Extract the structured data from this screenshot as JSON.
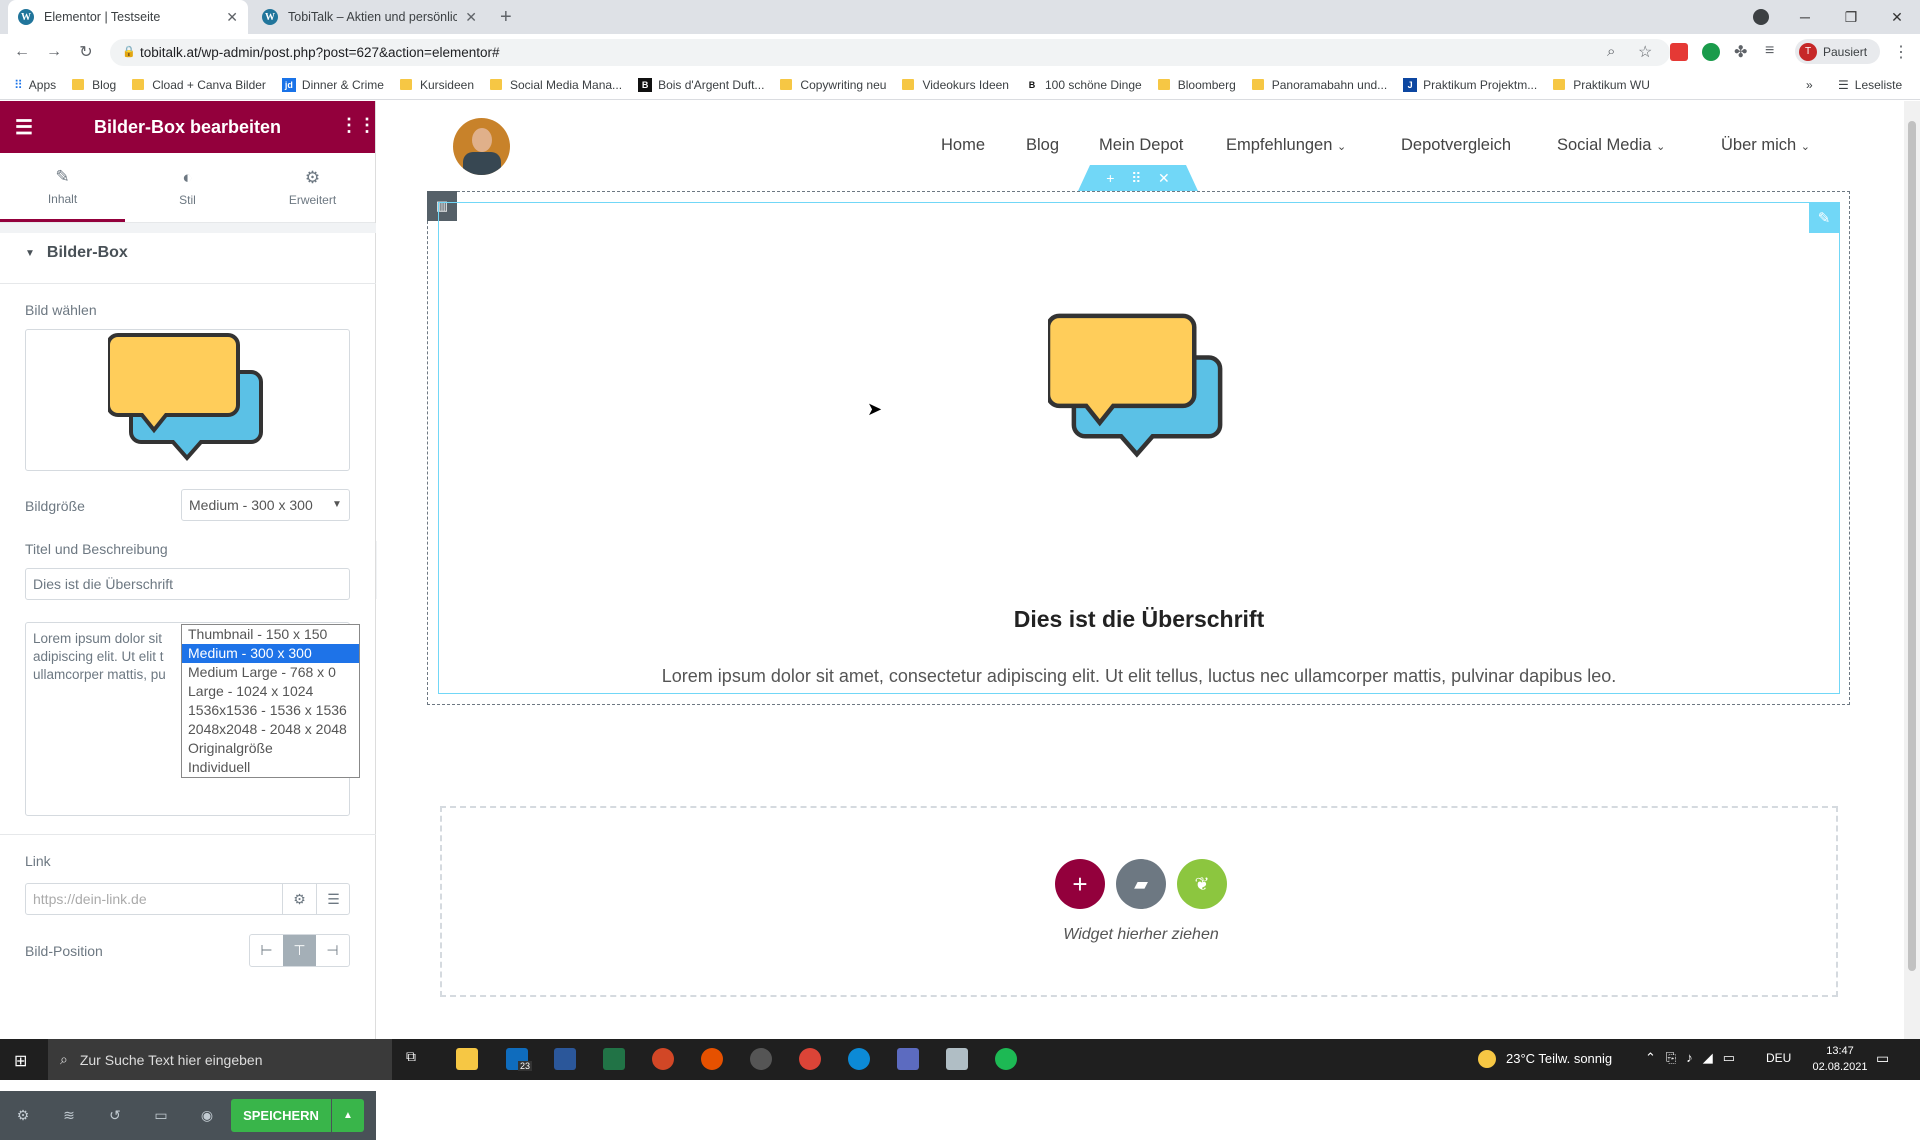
{
  "browser": {
    "tabs": [
      {
        "title": "Elementor | Testseite",
        "active": true
      },
      {
        "title": "TobiTalk – Aktien und persönliche",
        "active": false
      }
    ],
    "url": "tobitalk.at/wp-admin/post.php?post=627&action=elementor#",
    "profile_label": "Pausiert",
    "reading_list": "Leseliste",
    "bookmarks": [
      "Apps",
      "Blog",
      "Cload + Canva Bilder",
      "Dinner & Crime",
      "Kursideen",
      "Social Media Mana...",
      "Bois d'Argent Duft...",
      "Copywriting neu",
      "Videokurs Ideen",
      "100 schöne Dinge",
      "Bloomberg",
      "Panoramabahn und...",
      "Praktikum Projektm...",
      "Praktikum WU"
    ]
  },
  "panel": {
    "title": "Bilder-Box bearbeiten",
    "tabs": [
      "Inhalt",
      "Stil",
      "Erweitert"
    ],
    "section": "Bilder-Box",
    "image_label": "Bild wählen",
    "size_label": "Bildgröße",
    "size_value": "Medium - 300 x 300",
    "size_options": [
      "Thumbnail - 150 x 150",
      "Medium - 300 x 300",
      "Medium Large - 768 x 0",
      "Large - 1024 x 1024",
      "1536x1536 - 1536 x 1536",
      "2048x2048 - 2048 x 2048",
      "Originalgröße",
      "Individuell"
    ],
    "title_desc_label": "Titel und Beschreibung",
    "title_value": "Dies ist die Überschrift",
    "desc_value": "Lorem ipsum dolor sit amet, consectetur adipiscing elit. Ut elit tellus, luctus nec ullamcorper mattis, pulvinar dapibus leo.",
    "desc_visible": "Lorem ipsum dolor sit\nadipiscing elit. Ut elit t\nullamcorper mattis, pu",
    "link_label": "Link",
    "link_placeholder": "https://dein-link.de",
    "position_label": "Bild-Position",
    "save_label": "SPEICHERN"
  },
  "site": {
    "nav": [
      "Home",
      "Blog",
      "Mein Depot",
      "Empfehlungen",
      "Depotvergleich",
      "Social Media",
      "Über mich"
    ],
    "heading": "Dies ist die Überschrift",
    "body": "Lorem ipsum dolor sit amet, consectetur adipiscing elit. Ut elit tellus, luctus nec ullamcorper mattis, pulvinar dapibus leo.",
    "drop_hint": "Widget hierher ziehen"
  },
  "taskbar": {
    "search_placeholder": "Zur Suche Text hier eingeben",
    "weather": "23°C  Teilw. sonnig",
    "lang": "DEU",
    "time": "13:47",
    "date": "02.08.2021",
    "mail_badge": "23"
  },
  "colors": {
    "brand": "#93003c",
    "accent": "#71d7f7",
    "save": "#39b54a"
  }
}
